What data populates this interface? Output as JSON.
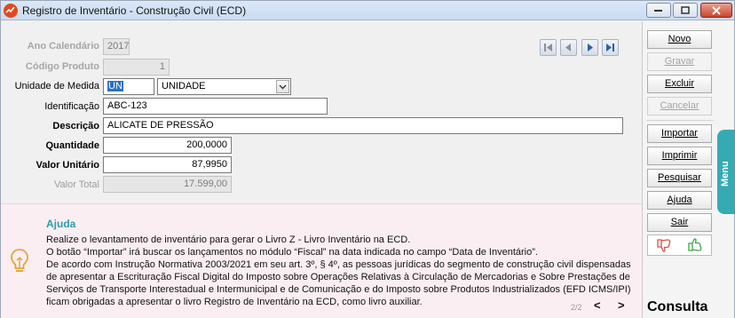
{
  "window": {
    "title": "Registro de Inventário - Construção Civil (ECD)"
  },
  "form": {
    "ano_calendario": {
      "label": "Ano Calendário",
      "value": "2017"
    },
    "codigo_produto": {
      "label": "Código Produto",
      "value": "1"
    },
    "unidade_medida": {
      "label": "Unidade de Medida",
      "code": "UN",
      "description": "UNIDADE"
    },
    "identificacao": {
      "label": "Identificação",
      "value": "ABC-123"
    },
    "descricao": {
      "label": "Descrição",
      "value": "ALICATE DE PRESSÃO"
    },
    "quantidade": {
      "label": "Quantidade",
      "value": "200,0000"
    },
    "valor_unitario": {
      "label": "Valor Unitário",
      "value": "87,9950"
    },
    "valor_total": {
      "label": "Valor Total",
      "value": "17.599,00"
    }
  },
  "navigation": [
    "first",
    "previous",
    "next",
    "last"
  ],
  "sidebar": {
    "novo": "Novo",
    "gravar": "Gravar",
    "excluir": "Excluir",
    "cancelar": "Cancelar",
    "importar": "Importar",
    "imprimir": "Imprimir",
    "pesquisar": "Pesquisar",
    "ajuda": "Ajuda",
    "sair": "Sair",
    "menu_tab": "Menu",
    "mode": "Consulta"
  },
  "help": {
    "title": "Ajuda",
    "lines": [
      "Realize o levantamento de inventário para gerar o Livro Z - Livro Inventário na ECD.",
      "O botão “Importar” irá buscar os lançamentos no módulo “Fiscal” na data indicada no campo “Data de Inventário”.",
      "De acordo com Instrução Normativa 2003/2021 em seu art. 3º, § 4º, as pessoas jurídicas do segmento de construção civil dispensadas",
      "de apresentar a Escrituração Fiscal Digital do Imposto sobre Operações Relativas à Circulação de Mercadorias e Sobre Prestações de",
      "Serviços de Transporte Interestadual e Intermunicipal e de Comunicação e do Imposto sobre Produtos Industrializados (EFD ICMS/IPI)",
      "ficam obrigadas a apresentar o livro Registro de Inventário na ECD, como livro auxiliar."
    ],
    "page": "2/2",
    "prev": "<",
    "next": ">"
  },
  "colors": {
    "accent": "#35aab3",
    "help_bg": "#fbeef2",
    "help_title": "#2a9ea8",
    "selection": "#2d6fc7"
  }
}
